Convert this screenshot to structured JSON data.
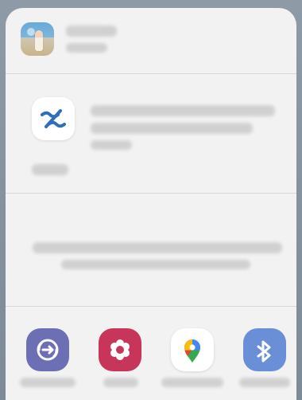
{
  "sheet": {
    "header": {
      "avatar_icon": "photo-thumbnail",
      "title_text": "",
      "subtitle_text": ""
    },
    "featured": {
      "app_icon": "app-logo-icon",
      "title_text": "",
      "subtitle_text": ""
    },
    "middle": {
      "text": ""
    },
    "share_targets": [
      {
        "name": "",
        "icon": "smart-switch-icon",
        "bg": "#6c6fb4"
      },
      {
        "name": "",
        "icon": "flower-icon",
        "bg": "#c7355a"
      },
      {
        "name": "",
        "icon": "maps-pin-icon",
        "bg": "#ffffff"
      },
      {
        "name": "",
        "icon": "bluetooth-icon",
        "bg": "#6a8fd6"
      }
    ]
  }
}
